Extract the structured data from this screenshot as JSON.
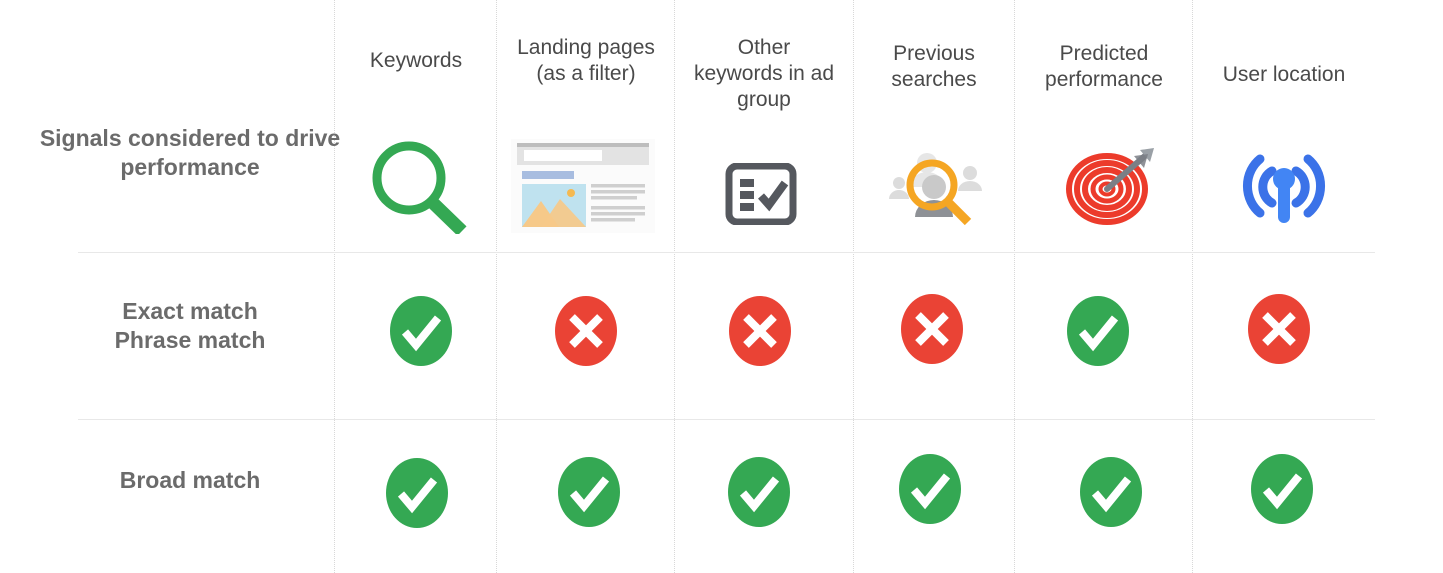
{
  "table": {
    "row_labels": {
      "signals": "Signals considered to drive performance",
      "exact_phrase": "Exact match\nPhrase match",
      "broad": "Broad match"
    },
    "columns": [
      {
        "id": "keywords",
        "label": "Keywords",
        "icon": "green-magnifier-icon"
      },
      {
        "id": "landing-pages",
        "label": "Landing pages\n(as a filter)",
        "icon": "landing-page-icon"
      },
      {
        "id": "other-keywords",
        "label": "Other keywords in ad group",
        "icon": "checklist-icon"
      },
      {
        "id": "previous-searches",
        "label": "Previous searches",
        "icon": "people-search-icon"
      },
      {
        "id": "predicted-perf",
        "label": "Predicted performance",
        "icon": "target-dart-icon"
      },
      {
        "id": "user-location",
        "label": "User location",
        "icon": "broadcast-signal-icon"
      }
    ],
    "rows": [
      {
        "id": "exact-phrase-match",
        "label": "Exact match\nPhrase match",
        "values": [
          "yes",
          "no",
          "no",
          "no",
          "yes",
          "no"
        ]
      },
      {
        "id": "broad-match",
        "label": "Broad match",
        "values": [
          "yes",
          "yes",
          "yes",
          "yes",
          "yes",
          "yes"
        ]
      }
    ]
  },
  "colors": {
    "yes": "#34A853",
    "no": "#EA4335",
    "label_text": "#6b6b6b",
    "header_text": "#4a4a4a",
    "grid_line": "#d8d8d8",
    "divider": "#e8e8e8",
    "magnifier_green": "#34A853",
    "target_red": "#EC3B2B",
    "signal_blue": "#3B72E8",
    "search_orange": "#F5A623",
    "checklist_gray": "#55585E"
  }
}
